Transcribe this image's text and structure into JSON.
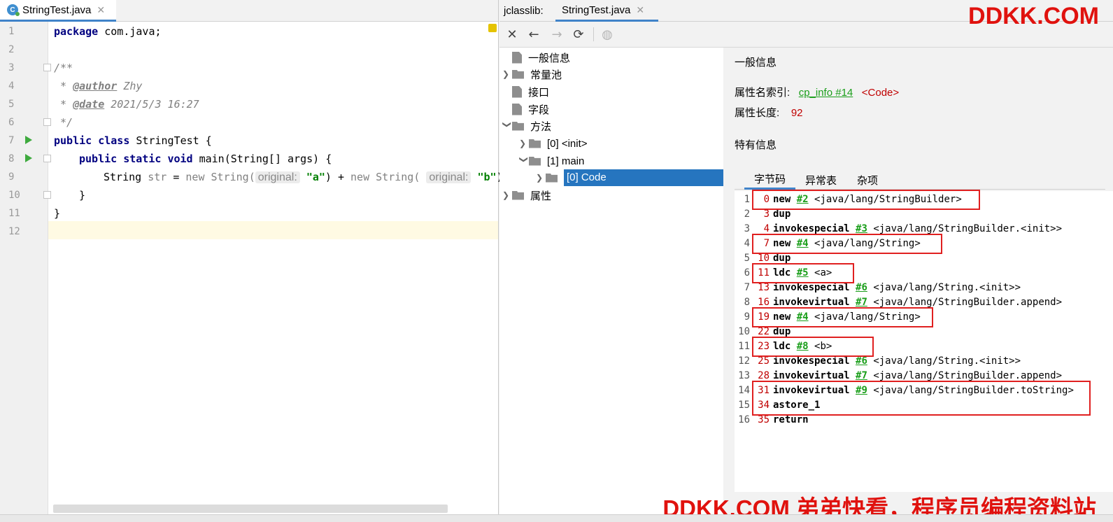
{
  "editor": {
    "tab": {
      "icon_letter": "C",
      "label": "StringTest.java"
    },
    "line_numbers": [
      "1",
      "2",
      "3",
      "4",
      "5",
      "6",
      "7",
      "8",
      "9",
      "10",
      "11",
      "12"
    ],
    "code": {
      "l1": {
        "kw": "package",
        "rest": " com.java;"
      },
      "l3": "/**",
      "l4": {
        "prefix": " * ",
        "tag": "@author",
        "rest": " Zhy"
      },
      "l5": {
        "prefix": " * ",
        "tag": "@date",
        "rest": " 2021/5/3 16:27"
      },
      "l6": " */",
      "l7": {
        "kw1": "public",
        "kw2": "class",
        "rest": " StringTest {"
      },
      "l8": {
        "kw1": "public",
        "kw2": "static",
        "kw3": "void",
        "rest": " main(String[] args) {"
      },
      "l9": {
        "type": "String ",
        "var": "str",
        "eq": " = ",
        "new1": "new",
        "ctor1": " String(",
        "hint1": "original:",
        "s1": "\"a\"",
        "plus": ") + ",
        "new2": "new",
        "ctor2": " String(",
        "hint2": "original:",
        "s2": "\"b\"",
        "close": ")"
      },
      "l10": "}",
      "l11": "}"
    }
  },
  "jclasslib": {
    "prefix": "jclasslib:",
    "tab_label": "StringTest.java",
    "toolbar": {
      "close": "✕",
      "back": "←",
      "forward": "→",
      "refresh": "⟳",
      "browser": "◍"
    },
    "tree": {
      "general": "一般信息",
      "constant_pool": "常量池",
      "interfaces": "接口",
      "fields": "字段",
      "methods": "方法",
      "init": "[0] <init>",
      "main": "[1] main",
      "code": "[0] Code",
      "attributes": "属性"
    },
    "details": {
      "general_title": "一般信息",
      "name_index_label": "属性名索引:",
      "name_index_link": "cp_info #14",
      "name_index_value": "<Code>",
      "length_label": "属性长度:",
      "length_value": "92",
      "specific_title": "特有信息",
      "tabs": [
        "字节码",
        "异常表",
        "杂项"
      ]
    },
    "bytecode": [
      {
        "no": "1",
        "off": "0",
        "op": "new",
        "ref": "#2",
        "arg": "<java/lang/StringBuilder>"
      },
      {
        "no": "2",
        "off": "3",
        "op": "dup",
        "ref": "",
        "arg": ""
      },
      {
        "no": "3",
        "off": "4",
        "op": "invokespecial",
        "ref": "#3",
        "arg": "<java/lang/StringBuilder.<init>>"
      },
      {
        "no": "4",
        "off": "7",
        "op": "new",
        "ref": "#4",
        "arg": "<java/lang/String>"
      },
      {
        "no": "5",
        "off": "10",
        "op": "dup",
        "ref": "",
        "arg": ""
      },
      {
        "no": "6",
        "off": "11",
        "op": "ldc",
        "ref": "#5",
        "arg": "<a>"
      },
      {
        "no": "7",
        "off": "13",
        "op": "invokespecial",
        "ref": "#6",
        "arg": "<java/lang/String.<init>>"
      },
      {
        "no": "8",
        "off": "16",
        "op": "invokevirtual",
        "ref": "#7",
        "arg": "<java/lang/StringBuilder.append>"
      },
      {
        "no": "9",
        "off": "19",
        "op": "new",
        "ref": "#4",
        "arg": "<java/lang/String>"
      },
      {
        "no": "10",
        "off": "22",
        "op": "dup",
        "ref": "",
        "arg": ""
      },
      {
        "no": "11",
        "off": "23",
        "op": "ldc",
        "ref": "#8",
        "arg": "<b>"
      },
      {
        "no": "12",
        "off": "25",
        "op": "invokespecial",
        "ref": "#6",
        "arg": "<java/lang/String.<init>>"
      },
      {
        "no": "13",
        "off": "28",
        "op": "invokevirtual",
        "ref": "#7",
        "arg": "<java/lang/StringBuilder.append>"
      },
      {
        "no": "14",
        "off": "31",
        "op": "invokevirtual",
        "ref": "#9",
        "arg": "<java/lang/StringBuilder.toString>"
      },
      {
        "no": "15",
        "off": "34",
        "op": "astore_1",
        "ref": "",
        "arg": ""
      },
      {
        "no": "16",
        "off": "35",
        "op": "return",
        "ref": "",
        "arg": ""
      }
    ]
  },
  "watermark": {
    "top": "DDKK.COM",
    "bottom": "DDKK.COM 弟弟快看，程序员编程资料站"
  },
  "colors": {
    "accent": "#4083c9",
    "highlight": "#e02020",
    "selection": "#2675bf",
    "link": "#1a9e1a"
  }
}
